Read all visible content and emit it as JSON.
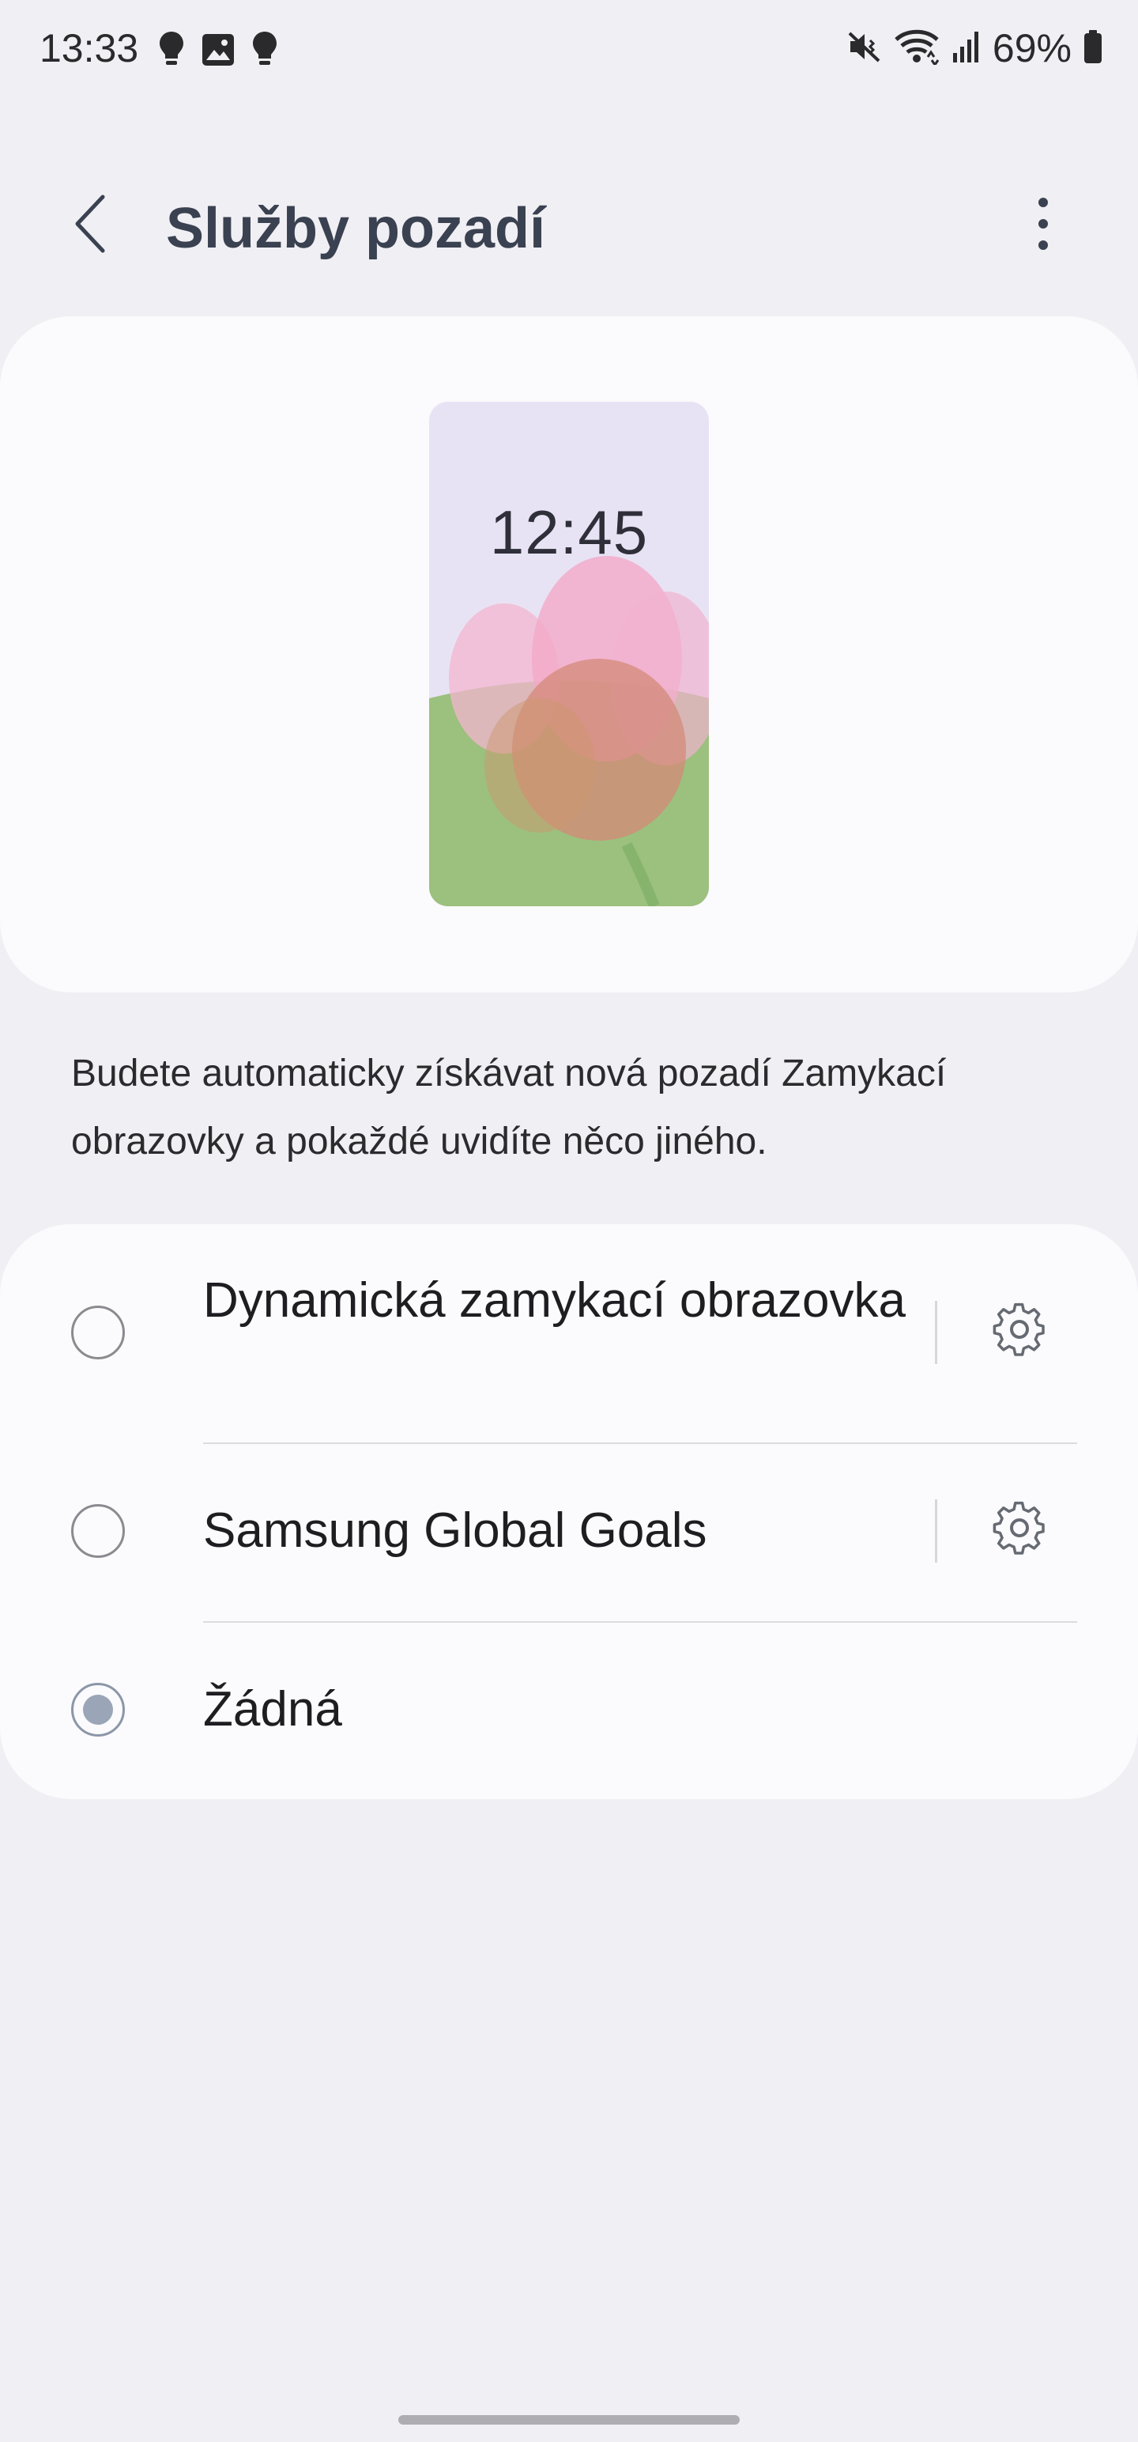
{
  "status_bar": {
    "time": "13:33",
    "battery_percent": "69%",
    "left_icons": [
      "bulb-icon",
      "image-icon",
      "bulb-icon"
    ],
    "right_icons": [
      "mute-vibrate-icon",
      "wifi-icon",
      "signal-icon",
      "battery-icon"
    ]
  },
  "app_bar": {
    "title": "Služby pozadí",
    "back_icon": "chevron-left-icon",
    "more_icon": "more-vertical-icon"
  },
  "preview": {
    "clock": "12:45"
  },
  "description": "Budete automaticky získávat nová pozadí Zamykací obrazovky a pokaždé uvidíte něco jiného.",
  "options": [
    {
      "label": "Dynamická zamykací obrazovka",
      "selected": false,
      "has_settings": true
    },
    {
      "label": "Samsung Global Goals",
      "selected": false,
      "has_settings": true
    },
    {
      "label": "Žádná",
      "selected": true,
      "has_settings": false
    }
  ],
  "colors": {
    "background": "#f0eff3",
    "card": "#fbfafc",
    "title": "#3a4150",
    "radio_selected": "#9aa6b7"
  }
}
